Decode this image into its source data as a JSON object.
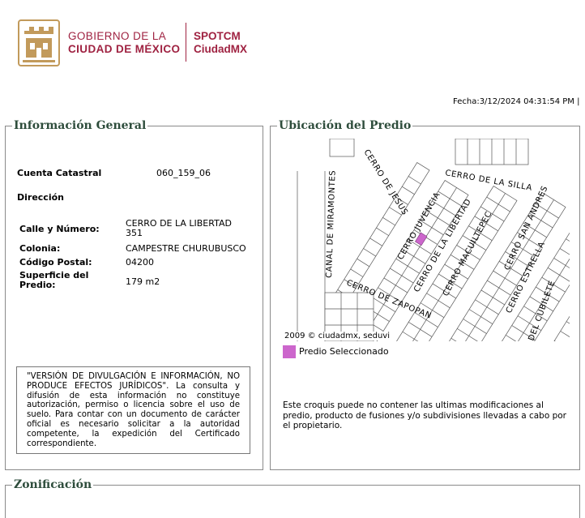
{
  "header": {
    "gov_line1": "GOBIERNO DE LA",
    "gov_line2": "CIUDAD DE MÉXICO",
    "app_line1": "SPOTCM",
    "app_line2": "CiudadMX",
    "fecha": "Fecha:3/12/2024 04:31:54 PM |"
  },
  "info": {
    "legend": "Información General",
    "cuenta_label": "Cuenta Catastral",
    "cuenta_value": "060_159_06",
    "direccion_label": "Dirección",
    "calle_label": "Calle y Número:",
    "calle_value": "CERRO DE LA LIBERTAD 351",
    "colonia_label": "Colonia:",
    "colonia_value": "CAMPESTRE CHURUBUSCO",
    "cp_label": "Código Postal:",
    "cp_value": "04200",
    "superficie_label": "Superficie del Predio:",
    "superficie_value": "179 m2",
    "disclaimer": "\"VERSIÓN DE DIVULGACIÓN E INFORMACIÓN, NO PRODUCE EFECTOS JURÍDICOS\". La consulta y difusión de esta información no constituye autorización, permiso o licencia sobre el uso de suelo. Para contar con un documento de carácter oficial es necesario solicitar a la autoridad competente, la expedición del Certificado correspondiente."
  },
  "ubicacion": {
    "legend": "Ubicación del Predio",
    "streets": {
      "s1": "CERRO DE JESUS",
      "s2": "CERRO DE LA SILLA",
      "s3": "CANAL DE MIRAMONTES",
      "s4": "CERRO JUVENCIA",
      "s5": "CERRO DE LA LIBERTAD",
      "s6": "CERRO MACUILTEPEC",
      "s7": "CERRO SAN ANDRES",
      "s8": "CERRO ESTRELLA",
      "s9": "CERRO DE ZAPOPAN",
      "s10": "DEL CUBILETE"
    },
    "copyright": "2009 © ciudadmx, seduvi",
    "legend_item": "Predio Seleccionado",
    "selected_color": "#cc66cc",
    "note": "Este croquis puede no contener las ultimas modificaciones al predio, producto de fusiones y/o subdivisiones llevadas a cabo por el propietario."
  },
  "zonificacion": {
    "legend": "Zonificación"
  }
}
